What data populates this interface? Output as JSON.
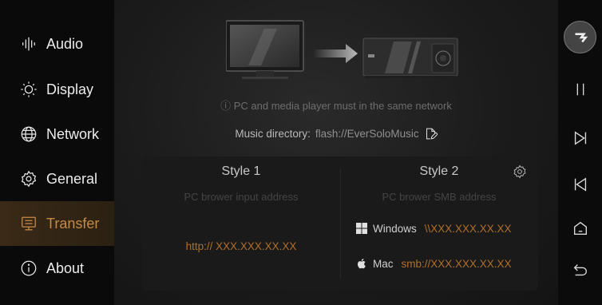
{
  "sidebar": {
    "items": [
      {
        "label": "Audio",
        "icon": "audio-wave-icon"
      },
      {
        "label": "Display",
        "icon": "sun-icon"
      },
      {
        "label": "Network",
        "icon": "globe-icon"
      },
      {
        "label": "General",
        "icon": "gear-icon"
      },
      {
        "label": "Transfer",
        "icon": "transfer-icon",
        "active": true
      },
      {
        "label": "About",
        "icon": "info-icon"
      }
    ]
  },
  "main": {
    "notice": "ⓘ PC and media player must in the same network",
    "directory_label": "Music directory:",
    "directory_value": "flash://EverSoloMusic",
    "style1": {
      "title": "Style 1",
      "subtitle": "PC brower input address",
      "address": "http:// XXX.XXX.XX.XX"
    },
    "style2": {
      "title": "Style 2",
      "subtitle": "PC brower SMB address",
      "windows_label": "Windows",
      "windows_address": "\\\\XXX.XXX.XX.XX",
      "mac_label": "Mac",
      "mac_address": "smb://XXX.XXX.XX.XX"
    }
  },
  "rightbar": {
    "buttons": [
      "logo-icon",
      "pause-icon",
      "next-icon",
      "previous-icon",
      "home-icon",
      "back-icon"
    ]
  },
  "colors": {
    "accent": "#c58a47",
    "address": "#b06f2c",
    "active_bg": "#3a2a17"
  }
}
